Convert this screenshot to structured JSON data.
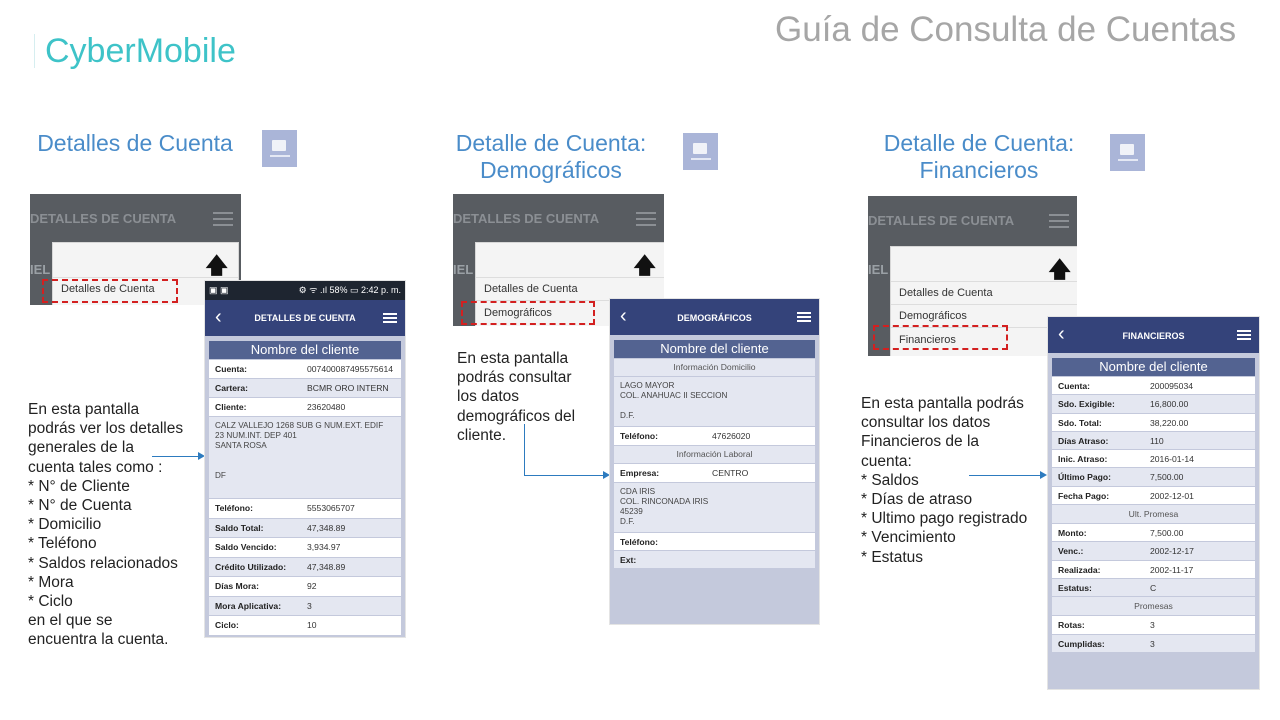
{
  "brand": "CyberMobile",
  "page_title": "Guía de Consulta de Cuentas",
  "sections": [
    {
      "heading": "Detalles de Cuenta",
      "crop_header": "DETALLES DE CUENTA",
      "crop_side": "IEL",
      "menu_items": [
        "Detalles de Cuenta"
      ],
      "description": "En esta pantalla\npodrás ver los detalles\ngenerales de la\ncuenta tales como :\n* N° de Cliente\n* N° de Cuenta\n* Domicilio\n* Teléfono\n* Saldos relacionados\n* Mora\n* Ciclo\nen el que se\nencuentra la cuenta.",
      "phone": {
        "status_left": "▣ ▣",
        "status_right": "⚙ ᯤ .ıl 58% ▭ 2:42 p. m.",
        "title": "DETALLES DE CUENTA",
        "name_label": "Nombre del cliente",
        "rows": [
          {
            "label": "Cuenta:",
            "value": "007400087495575614"
          },
          {
            "label": "Cartera:",
            "value": "BCMR ORO INTERN"
          },
          {
            "label": "Cliente:",
            "value": "23620480"
          }
        ],
        "address": "CALZ VALLEJO 1268 SUB G NUM.EXT. EDIF\n23 NUM.INT. DEP 401\nSANTA ROSA\n\n\nDF",
        "rows2": [
          {
            "label": "Teléfono:",
            "value": "5553065707"
          },
          {
            "label": "Saldo Total:",
            "value": "47,348.89"
          },
          {
            "label": "Saldo Vencido:",
            "value": "3,934.97"
          },
          {
            "label": "Crédito Utilizado:",
            "value": "47,348.89"
          },
          {
            "label": "Días Mora:",
            "value": "92"
          },
          {
            "label": "Mora Aplicativa:",
            "value": "3"
          },
          {
            "label": "Ciclo:",
            "value": "10"
          }
        ]
      }
    },
    {
      "heading": "Detalle de Cuenta:\nDemográficos",
      "crop_header": "DETALLES DE CUENTA",
      "crop_side": "IEL",
      "menu_items": [
        "Detalles de Cuenta",
        "Demográficos"
      ],
      "description": "En esta pantalla\npodrás consultar\nlos datos\ndemográficos del\ncliente.",
      "phone": {
        "title": "DEMOGRÁFICOS",
        "name_label": "Nombre del cliente",
        "domicilio_label": "Información Domicilio",
        "domicilio": "LAGO MAYOR\nCOL. ANAHUAC II SECCION\n\nD.F.",
        "tel_label": "Teléfono:",
        "tel_value": "47626020",
        "laboral_label": "Información Laboral",
        "empresa_label": "Empresa:",
        "empresa_value": "CENTRO",
        "laboral": "CDA IRIS\nCOL. RINCONADA IRIS\n45239\nD.F.",
        "tel2_label": "Teléfono:",
        "ext_label": "Ext:"
      }
    },
    {
      "heading": "Detalle de Cuenta:\nFinancieros",
      "crop_header": "DETALLES DE CUENTA",
      "crop_side": "IEL",
      "menu_items": [
        "Detalles de Cuenta",
        "Demográficos",
        "Financieros"
      ],
      "description": "En esta pantalla podrás\nconsultar los datos\nFinancieros de la\ncuenta:\n* Saldos\n* Días de atraso\n* Ultimo pago registrado\n* Vencimiento\n* Estatus",
      "phone": {
        "title": "FINANCIEROS",
        "name_label": "Nombre del cliente",
        "rows": [
          {
            "label": "Cuenta:",
            "value": "200095034"
          },
          {
            "label": "Sdo. Exigible:",
            "value": "16,800.00"
          },
          {
            "label": "Sdo. Total:",
            "value": "38,220.00"
          },
          {
            "label": "Días Atraso:",
            "value": "110"
          },
          {
            "label": "Inic. Atraso:",
            "value": "2016-01-14"
          },
          {
            "label": "Último Pago:",
            "value": "7,500.00"
          },
          {
            "label": "Fecha Pago:",
            "value": "2002-12-01"
          }
        ],
        "promesa_label": "Ult. Promesa",
        "rows2": [
          {
            "label": "Monto:",
            "value": "7,500.00"
          },
          {
            "label": "Venc.:",
            "value": "2002-12-17"
          },
          {
            "label": "Realizada:",
            "value": "2002-11-17"
          },
          {
            "label": "Estatus:",
            "value": "C"
          }
        ],
        "promesas_label": "Promesas",
        "rows3": [
          {
            "label": "Rotas:",
            "value": "3"
          },
          {
            "label": "Cumplidas:",
            "value": "3"
          }
        ]
      }
    }
  ]
}
